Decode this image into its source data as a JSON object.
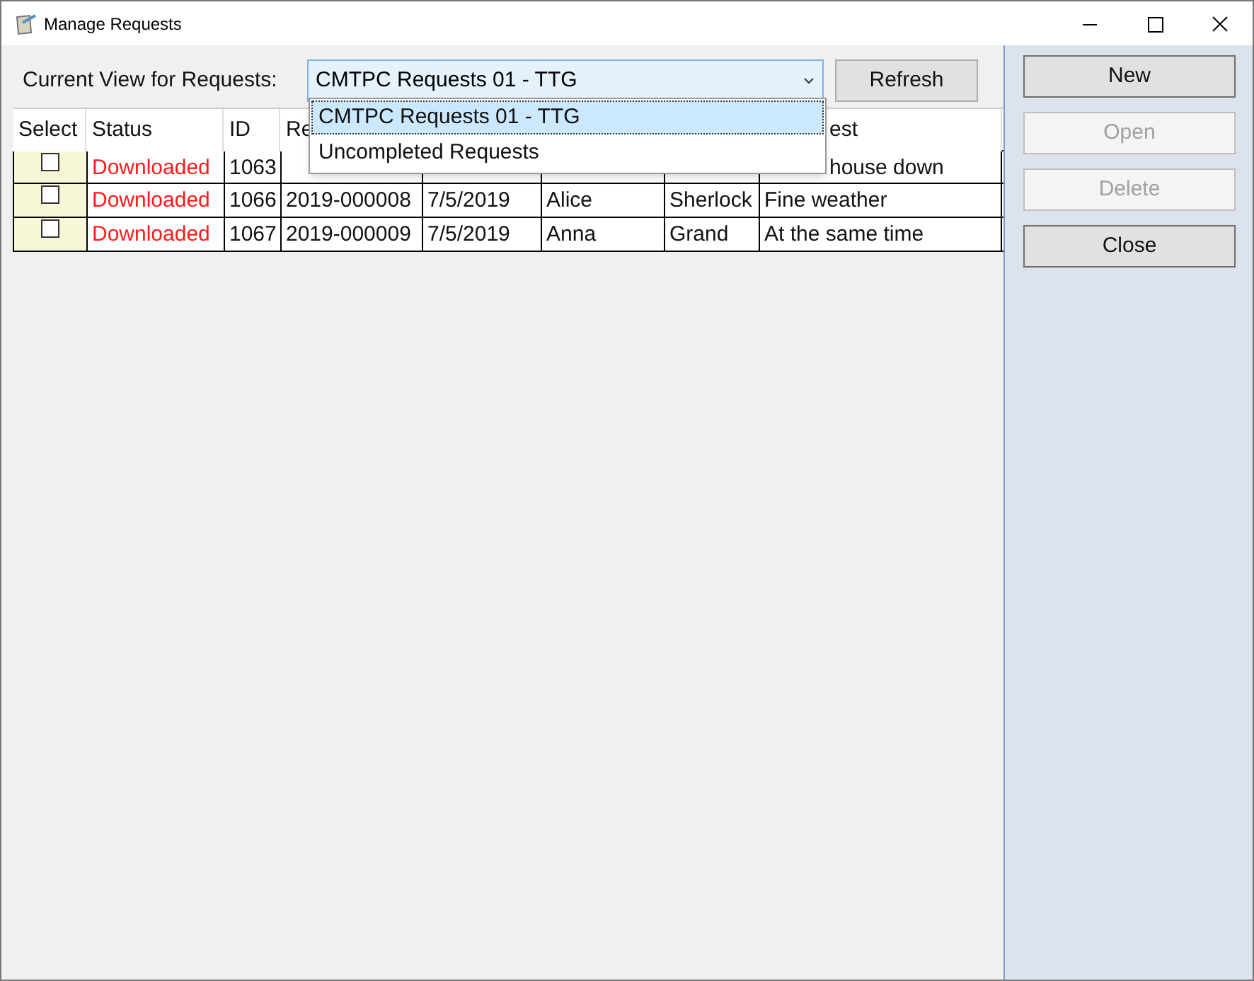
{
  "window": {
    "title": "Manage Requests"
  },
  "view_label": "Current View for Requests:",
  "view_select": {
    "value": "CMTPC Requests 01 - TTG",
    "expanded": true,
    "options": [
      {
        "label": "CMTPC Requests 01 - TTG",
        "selected": true
      },
      {
        "label": "Uncompleted Requests",
        "selected": false
      }
    ]
  },
  "refresh_button": "Refresh",
  "table": {
    "columns": [
      "Select",
      "Status",
      "ID",
      "Re",
      "",
      "",
      "",
      "est"
    ],
    "rows": [
      {
        "checked": false,
        "cells": [
          "",
          "Downloaded",
          "1063",
          "",
          "",
          "",
          "",
          "house down"
        ]
      },
      {
        "checked": false,
        "cells": [
          "",
          "Downloaded",
          "1066",
          "2019-000008",
          "7/5/2019",
          "Alice",
          "Sherlock",
          "Fine weather"
        ]
      },
      {
        "checked": false,
        "cells": [
          "",
          "Downloaded",
          "1067",
          "2019-000009",
          "7/5/2019",
          "Anna",
          "Grand",
          "At the same time"
        ]
      }
    ]
  },
  "side_buttons": [
    {
      "label": "New",
      "disabled": false
    },
    {
      "label": "Open",
      "disabled": true
    },
    {
      "label": "Delete",
      "disabled": true
    },
    {
      "label": "Close",
      "disabled": false
    }
  ]
}
